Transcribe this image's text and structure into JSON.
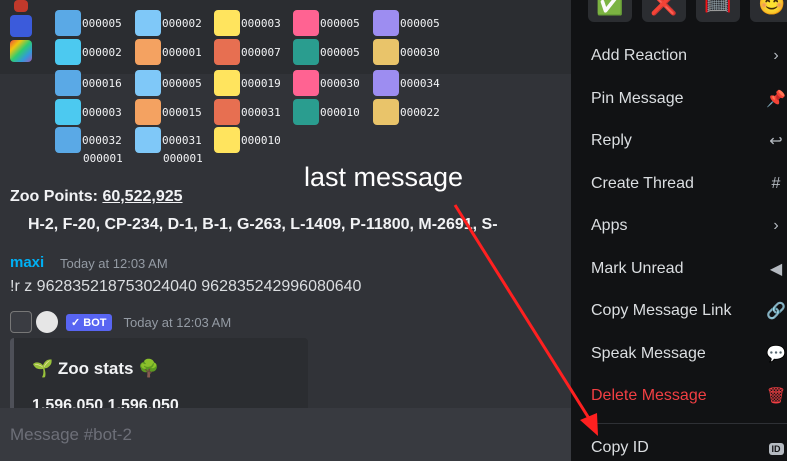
{
  "grid": {
    "rows": [
      [
        "000005",
        "000002",
        "000003",
        "000005",
        "000005"
      ],
      [
        "000002",
        "000001",
        "000007",
        "000005",
        "000030"
      ],
      [
        "000016",
        "000005",
        "000019",
        "000030",
        "000034"
      ],
      [
        "000003",
        "000015",
        "000031",
        "000010",
        "000022"
      ],
      [
        "000032",
        "000031",
        "000010"
      ],
      [
        "000001",
        "000001"
      ]
    ]
  },
  "zoo": {
    "points_label": "Zoo Points:",
    "points_value": "60,522,925",
    "breakdown": "H-2, F-20, CP-234, D-1, B-1, G-263, L-1409, P-11800, M-2691, S-"
  },
  "annotation": {
    "text": "last message"
  },
  "message": {
    "author": "maxi",
    "time": "Today at 12:03 AM",
    "text": "!r z 962835218753024040 962835242996080640"
  },
  "bot_message": {
    "badge": "✓ BOT",
    "time": "Today at 12:03 AM",
    "embed_title": "🌱 Zoo stats 🌳",
    "embed_line": "1,596,050 1,596,050"
  },
  "input": {
    "placeholder": "Message #bot-2"
  },
  "menu": {
    "reactions": [
      "✅",
      "❌",
      "🥅",
      "😊"
    ],
    "items": [
      {
        "label": "Add Reaction",
        "icon": "chevron-right"
      },
      {
        "label": "Pin Message",
        "icon": "pin"
      },
      {
        "label": "Reply",
        "icon": "reply"
      },
      {
        "label": "Create Thread",
        "icon": "thread"
      },
      {
        "label": "Apps",
        "icon": "chevron-right"
      },
      {
        "label": "Mark Unread",
        "icon": "unread"
      },
      {
        "label": "Copy Message Link",
        "icon": "link"
      },
      {
        "label": "Speak Message",
        "icon": "speak"
      },
      {
        "label": "Delete Message",
        "icon": "trash"
      },
      {
        "label": "Copy ID",
        "icon": "id-badge"
      }
    ],
    "id_badge": "ID"
  },
  "colors": {
    "accent_blue": "#00b0f4",
    "danger": "#f23f43",
    "blurple": "#5865f2",
    "arrow": "#ff2020"
  }
}
